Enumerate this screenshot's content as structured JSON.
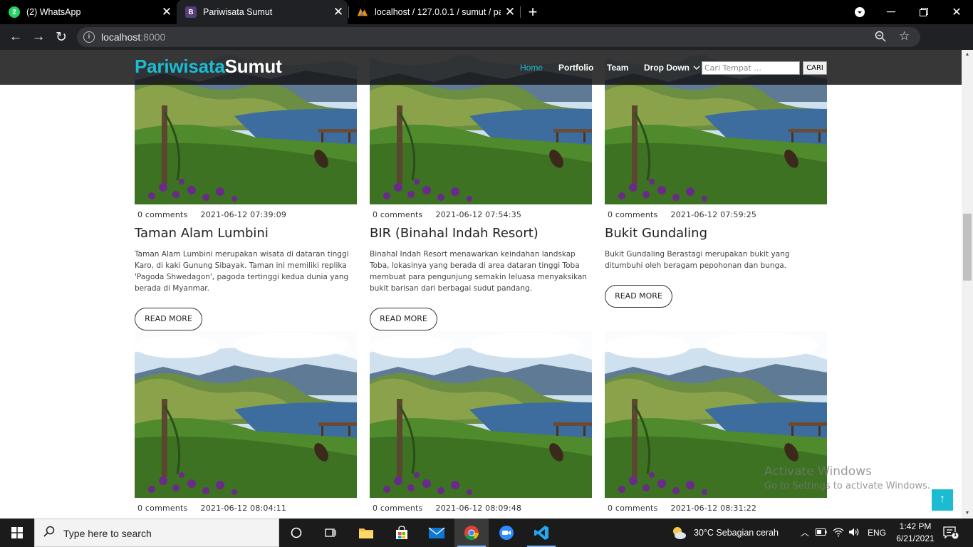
{
  "browser": {
    "tabs": [
      {
        "title": "(2) WhatsApp",
        "badge": "2"
      },
      {
        "title": "Pariwisata Sumut",
        "badge": "B"
      },
      {
        "title": "localhost / 127.0.0.1 / sumut / pa"
      }
    ],
    "url_host": "localhost",
    "url_port": ":8000"
  },
  "site": {
    "logo_part1": "Pariwisata",
    "logo_part2": "Sumut",
    "nav": {
      "home": "Home",
      "portfolio": "Portfolio",
      "team": "Team",
      "dropdown": "Drop Down"
    },
    "search_placeholder": "Cari Tempat ...",
    "search_button": "CARI",
    "read_more": "READ MORE"
  },
  "posts": [
    {
      "comments": "0 comments",
      "date": "2021-06-12 07:39:09",
      "title": "Taman Alam Lumbini",
      "desc": "Taman Alam Lumbini merupakan wisata di dataran tinggi Karo, di kaki Gunung Sibayak. Taman ini memiliki replika 'Pagoda Shwedagon', pagoda tertinggi kedua dunia yang berada di Myanmar."
    },
    {
      "comments": "0 comments",
      "date": "2021-06-12 07:54:35",
      "title": "BIR (Binahal Indah Resort)",
      "desc": "Binahal Indah Resort menawarkan keindahan landskap Toba, lokasinya yang berada di area dataran tinggi Toba membuat para pengunjung semakin leluasa menyaksikan bukit barisan dari berbagai sudut pandang."
    },
    {
      "comments": "0 comments",
      "date": "2021-06-12 07:59:25",
      "title": "Bukit Gundaling",
      "desc": "Bukit Gundaling Berastagi merupakan bukit yang ditumbuhi oleh beragam pepohonan dan bunga."
    },
    {
      "comments": "0 comments",
      "date": "2021-06-12 08:04:11"
    },
    {
      "comments": "0 comments",
      "date": "2021-06-12 08:09:48"
    },
    {
      "comments": "0 comments",
      "date": "2021-06-12 08:31:22"
    }
  ],
  "watermark": {
    "line1": "Activate Windows",
    "line2": "Go to Settings to activate Windows."
  },
  "taskbar": {
    "search_placeholder": "Type here to search",
    "weather": "30°C  Sebagian cerah",
    "lang": "ENG",
    "time": "1:42 PM",
    "date": "6/21/2021",
    "notif_count": "1"
  },
  "colors": {
    "brand": "#1bbcd1",
    "navbar": "#141414"
  }
}
